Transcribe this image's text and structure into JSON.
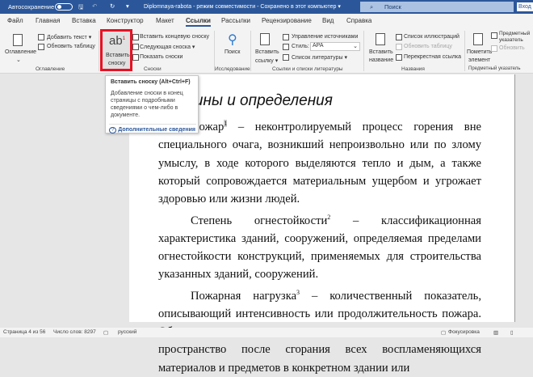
{
  "titlebar": {
    "autosave": "Автосохранение",
    "doc_title": "Diplomnaya-rabota - режим совместимости - Сохранено в этот компьютер ▾",
    "search": "Поиск",
    "signin": "Вход"
  },
  "tabs": [
    "Файл",
    "Главная",
    "Вставка",
    "Конструктор",
    "Макет",
    "Ссылки",
    "Рассылки",
    "Рецензирование",
    "Вид",
    "Справка"
  ],
  "ribbon": {
    "toc": {
      "label": "Оглавление",
      "add_text": "Добавить текст ▾",
      "update_table": "Обновить таблицу",
      "group": "Оглавление"
    },
    "footnotes": {
      "insert": "Вставить",
      "insert2": "сноску",
      "endnote": "Вставить концевую сноску",
      "next": "Следующая сноска ▾",
      "show": "Показать сноски",
      "group": "Сноски"
    },
    "research": {
      "search": "Поиск",
      "group": "Исследование"
    },
    "citations": {
      "insert": "Вставить",
      "insert2": "ссылку ▾",
      "manage": "Управление источниками",
      "style_label": "Стиль:",
      "style_value": "APA",
      "biblio": "Список литературы ▾",
      "group": "Ссылки и списки литературы"
    },
    "captions": {
      "insert": "Вставить",
      "insert2": "название",
      "figures": "Список иллюстраций",
      "update": "Обновить таблицу",
      "crossref": "Перекрестная ссылка",
      "group": "Названия"
    },
    "index": {
      "mark": "Пометить",
      "mark2": "элемент",
      "subject": "Предметный указатель",
      "update": "Обновить",
      "group": "Предметный указатель"
    }
  },
  "tooltip": {
    "title": "Вставить сноску (Alt+Ctrl+F)",
    "body": "Добавление сноски в конец страницы с подробными сведениями о чем-либо в документе.",
    "link": "Дополнительные сведения"
  },
  "document": {
    "heading": "Термины и определения",
    "p1_term": "Пожар",
    "p1_sup": "1",
    "p1": " – неконтролируемый процесс горения вне специального очага, возникший непроизвольно или по злому умыслу, в ходе которого выделяются тепло и дым, а также который сопровождается материальным ущербом и угрожает здоровью или жизни людей.",
    "p2_term": "Степень огнестойкости",
    "p2_sup": "2",
    "p2": " – классификационная характеристика зданий, сооружений, определяемая пределами огнестойкости конструкций, применяемых для строительства указанных зданий, сооружений.",
    "p3_term": "Пожарная нагрузка",
    "p3_sup": "3",
    "p3": " – количественный показатель, описывающий интенсивность или продолжительность пожара. Общее количество теплоты, выделяющееся в окружающее пространство после сгорания всех воспламеняющихся материалов и предметов в конкретном здании или"
  },
  "status": {
    "page": "Страница 4 из 56",
    "words": "Число слов: 8297",
    "lang": "русский",
    "focus": "Фокусировка"
  }
}
